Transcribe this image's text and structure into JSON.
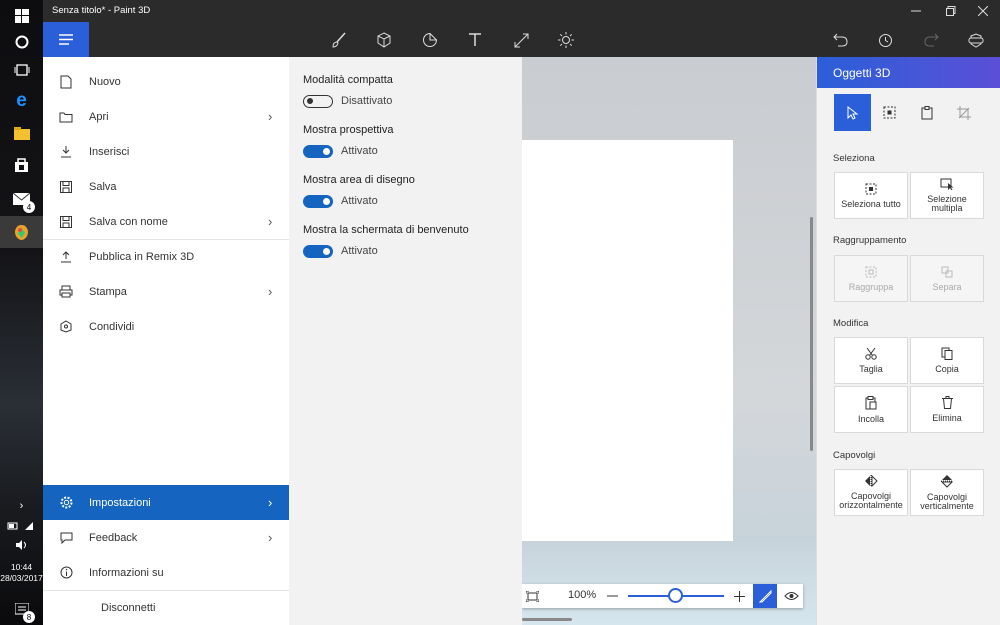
{
  "window": {
    "title": "Senza titolo* - Paint 3D"
  },
  "taskbar": {
    "mail_badge": "4",
    "notification_badge": "8",
    "time": "10:44",
    "date": "28/03/2017"
  },
  "file_menu": {
    "items": [
      {
        "label": "Nuovo"
      },
      {
        "label": "Apri"
      },
      {
        "label": "Inserisci"
      },
      {
        "label": "Salva"
      },
      {
        "label": "Salva con nome"
      },
      {
        "label": "Pubblica in Remix 3D"
      },
      {
        "label": "Stampa"
      },
      {
        "label": "Condividi"
      }
    ],
    "bottom_items": [
      {
        "label": "Impostazioni"
      },
      {
        "label": "Feedback"
      },
      {
        "label": "Informazioni su"
      },
      {
        "label": "Disconnetti"
      }
    ]
  },
  "settings": {
    "options": [
      {
        "title": "Modalità compatta",
        "state": "Disattivato",
        "on": false
      },
      {
        "title": "Mostra prospettiva",
        "state": "Attivato",
        "on": true
      },
      {
        "title": "Mostra area di disegno",
        "state": "Attivato",
        "on": true
      },
      {
        "title": "Mostra la schermata di benvenuto",
        "state": "Attivato",
        "on": true
      }
    ]
  },
  "zoom": {
    "label": "100%",
    "level_fraction": 0.5
  },
  "right_panel": {
    "title": "Oggetti 3D",
    "sections": {
      "seleziona": "Seleziona",
      "raggruppamento": "Raggruppamento",
      "modifica": "Modifica",
      "capovolgi": "Capovolgi"
    },
    "buttons": {
      "select_all": "Seleziona tutto",
      "multi_select": "Selezione multipla",
      "group": "Raggruppa",
      "ungroup": "Separa",
      "cut": "Taglia",
      "copy": "Copia",
      "paste": "Incolla",
      "delete": "Elimina",
      "flip_h": "Capovolgi orizzontalmente",
      "flip_v": "Capovolgi verticalmente"
    }
  },
  "colors": {
    "accent": "#2b5fd9",
    "menu_active": "#1565c0",
    "titlebar": "#2b2b2b"
  }
}
